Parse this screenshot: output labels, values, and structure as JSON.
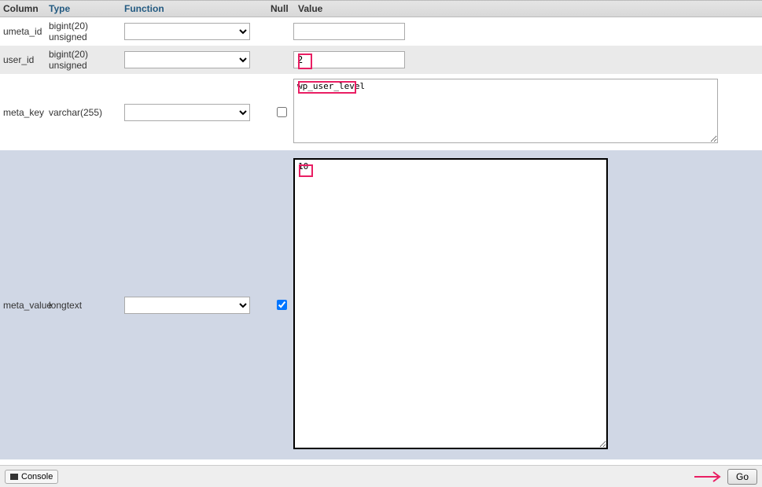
{
  "headers": {
    "column": "Column",
    "type": "Type",
    "function": "Function",
    "null": "Null",
    "value": "Value"
  },
  "rows": [
    {
      "column": "umeta_id",
      "type": "bigint(20) unsigned",
      "null_visible": false,
      "null_checked": false,
      "value_kind": "input",
      "value": ""
    },
    {
      "column": "user_id",
      "type": "bigint(20) unsigned",
      "null_visible": false,
      "null_checked": false,
      "value_kind": "input",
      "value": "2"
    },
    {
      "column": "meta_key",
      "type": "varchar(255)",
      "null_visible": true,
      "null_checked": false,
      "value_kind": "textarea_sm",
      "value": "wp_user_level"
    },
    {
      "column": "meta_value",
      "type": "longtext",
      "null_visible": true,
      "null_checked": true,
      "value_kind": "textarea_lg",
      "value": "10"
    }
  ],
  "bottom": {
    "console": "Console",
    "go": "Go"
  }
}
